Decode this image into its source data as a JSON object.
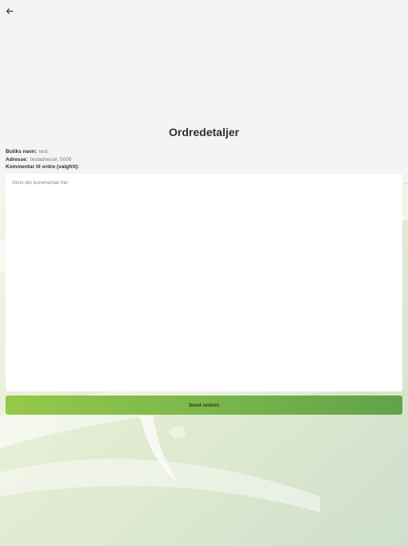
{
  "header": {
    "back_icon": "arrow-left-icon"
  },
  "page": {
    "title": "Ordredetaljer"
  },
  "order_info": {
    "shop_label": "Butiks navn:",
    "shop_value": "test",
    "address_label": "Adresse:",
    "address_value": "testadresse, 5000",
    "comment_label": "Kommentar til ordre (valgfrit):"
  },
  "comment": {
    "placeholder": "Skriv din kommentar her",
    "value": ""
  },
  "actions": {
    "send_label": "Send ordren"
  },
  "colors": {
    "background": "#f4f4f4",
    "accent_green": "#7bb74a",
    "title_text": "#2b2f33"
  }
}
